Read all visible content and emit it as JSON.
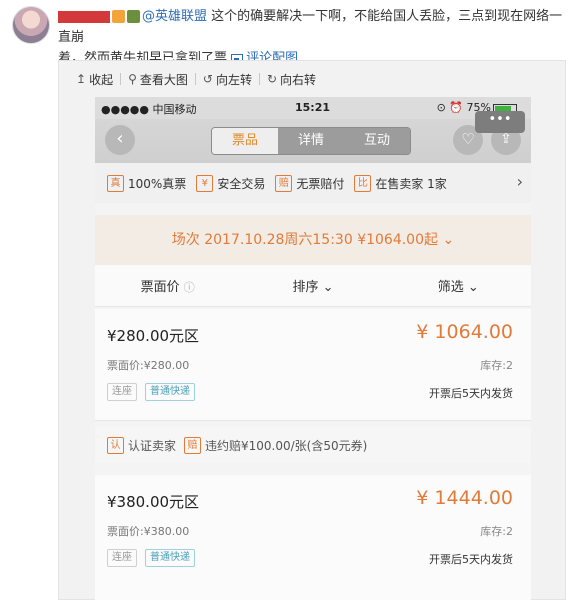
{
  "post": {
    "mention": "@英雄联盟",
    "text_line1": " 这个的确要解决一下啊，不能给国人丢脸，三点到现在网络一直崩",
    "text_line2": "着，然而黄牛却早已拿到了票 ",
    "link_label": "评论配图"
  },
  "toolbar": {
    "collapse": "收起",
    "view_large": "查看大图",
    "rotate_left": "向左转",
    "rotate_right": "向右转"
  },
  "phone": {
    "status": {
      "carrier": "●●●●● 中国移动",
      "time": "15:21",
      "battery": "75%"
    },
    "tabs": [
      "票品",
      "详情",
      "互动"
    ],
    "active_tab": "票品",
    "features": [
      {
        "icon": "真",
        "label": "100%真票"
      },
      {
        "icon": "¥",
        "label": "安全交易"
      },
      {
        "icon": "赔",
        "label": "无票赔付"
      },
      {
        "icon": "比",
        "label": "在售卖家 1家"
      }
    ],
    "session": "场次 2017.10.28周六15:30 ¥1064.00起 ⌄",
    "sort": {
      "face_price": "票面价",
      "order": "排序 ⌄",
      "filter": "筛选 ⌄"
    },
    "tickets": [
      {
        "zone": "¥280.00元区",
        "price": "¥ 1064.00",
        "face": "票面价:¥280.00",
        "stock": "库存:2",
        "tag_seat": "连座",
        "tag_delivery": "普通快递",
        "ship": "开票后5天内发货"
      },
      {
        "zone": "¥380.00元区",
        "price": "¥ 1444.00",
        "face": "票面价:¥380.00",
        "stock": "库存:2",
        "tag_seat": "连座",
        "tag_delivery": "普通快递",
        "ship": "开票后5天内发货"
      }
    ],
    "seller": {
      "verified_icon": "认",
      "verified": "认证卖家",
      "penalty_icon": "赔",
      "penalty": "违约赔¥100.00/张(含50元券)"
    }
  }
}
